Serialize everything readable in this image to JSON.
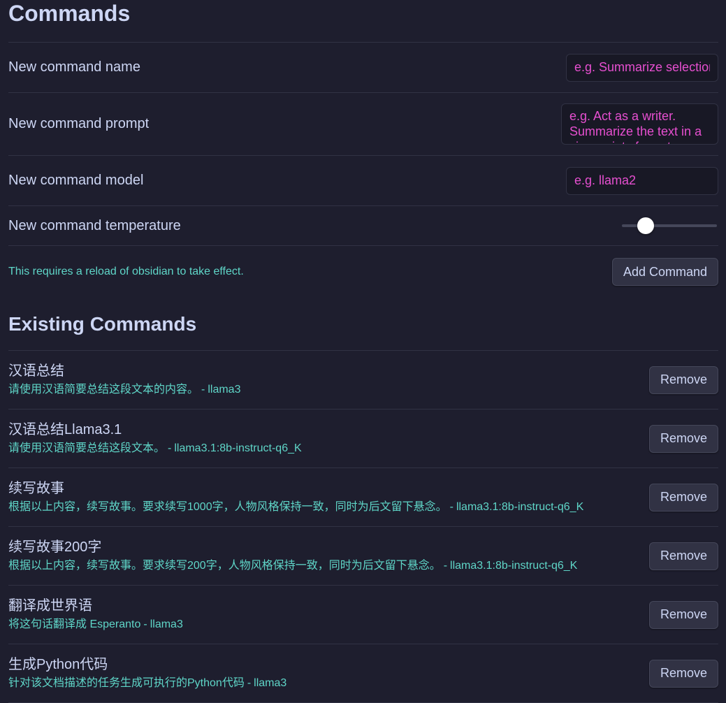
{
  "header": {
    "title": "Commands"
  },
  "new_command": {
    "name_label": "New command name",
    "name_placeholder": "e.g. Summarize selection",
    "prompt_label": "New command prompt",
    "prompt_placeholder": "e.g. Act as a writer. Summarize the text in a view points format.",
    "model_label": "New command model",
    "model_placeholder": "e.g. llama2",
    "temperature_label": "New command temperature",
    "temperature_value": 0.25,
    "reload_hint": "This requires a reload of obsidian to take effect.",
    "add_button_label": "Add Command"
  },
  "existing": {
    "title": "Existing Commands",
    "remove_label": "Remove",
    "commands": [
      {
        "name": "汉语总结",
        "prompt": "请使用汉语简要总结这段文本的内容。",
        "model": "llama3"
      },
      {
        "name": "汉语总结Llama3.1",
        "prompt": "请使用汉语简要总结这段文本。",
        "model": "llama3.1:8b-instruct-q6_K"
      },
      {
        "name": "续写故事",
        "prompt": "根据以上内容，续写故事。要求续写1000字，人物风格保持一致，同时为后文留下悬念。",
        "model": "llama3.1:8b-instruct-q6_K"
      },
      {
        "name": "续写故事200字",
        "prompt": "根据以上内容，续写故事。要求续写200字，人物风格保持一致，同时为后文留下悬念。",
        "model": "llama3.1:8b-instruct-q6_K"
      },
      {
        "name": "翻译成世界语",
        "prompt": "将这句话翻译成 Esperanto",
        "model": "llama3"
      },
      {
        "name": "生成Python代码",
        "prompt": "针对该文档描述的任务生成可执行的Python代码",
        "model": "llama3"
      }
    ]
  },
  "colors": {
    "background": "#1e1e2e",
    "accent_text": "#5fd6c8",
    "placeholder": "#e64fd0"
  }
}
